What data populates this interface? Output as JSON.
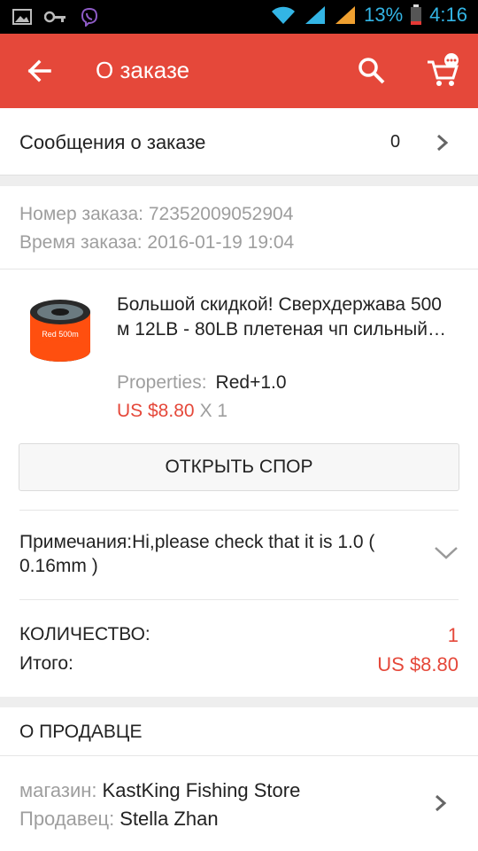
{
  "status_bar": {
    "battery_percent": "13%",
    "time": "4:16"
  },
  "app_bar": {
    "title": "О заказе"
  },
  "messages": {
    "label": "Сообщения о заказе",
    "count": "0"
  },
  "order": {
    "number_label": "Номер заказа:",
    "number": "72352009052904",
    "time_label": "Время заказа:",
    "time": "2016-01-19 19:04"
  },
  "product": {
    "thumb_text": "Red 500m",
    "title": "Большой скидкой! Сверхдержава 500 м 12LB - 80LB плетеная чп сильный…",
    "props_label": "Properties:",
    "props_value": "Red+1.0",
    "price": "US $8.80",
    "qty": "X 1"
  },
  "dispute_button": "ОТКРЫТЬ СПОР",
  "notes": "Примечания:Hi,please check that it is 1.0 ( 0.16mm )",
  "totals": {
    "qty_label": "КОЛИЧЕСТВО:",
    "qty_value": "1",
    "total_label": "Итого:",
    "total_value": "US $8.80"
  },
  "seller": {
    "heading": "О ПРОДАВЦЕ",
    "store_label": "магазин:",
    "store": "KastKing Fishing Store",
    "seller_label": "Продавец:",
    "seller_name": "Stella Zhan"
  },
  "colors": {
    "accent": "#e5483a",
    "muted": "#9e9e9e"
  }
}
